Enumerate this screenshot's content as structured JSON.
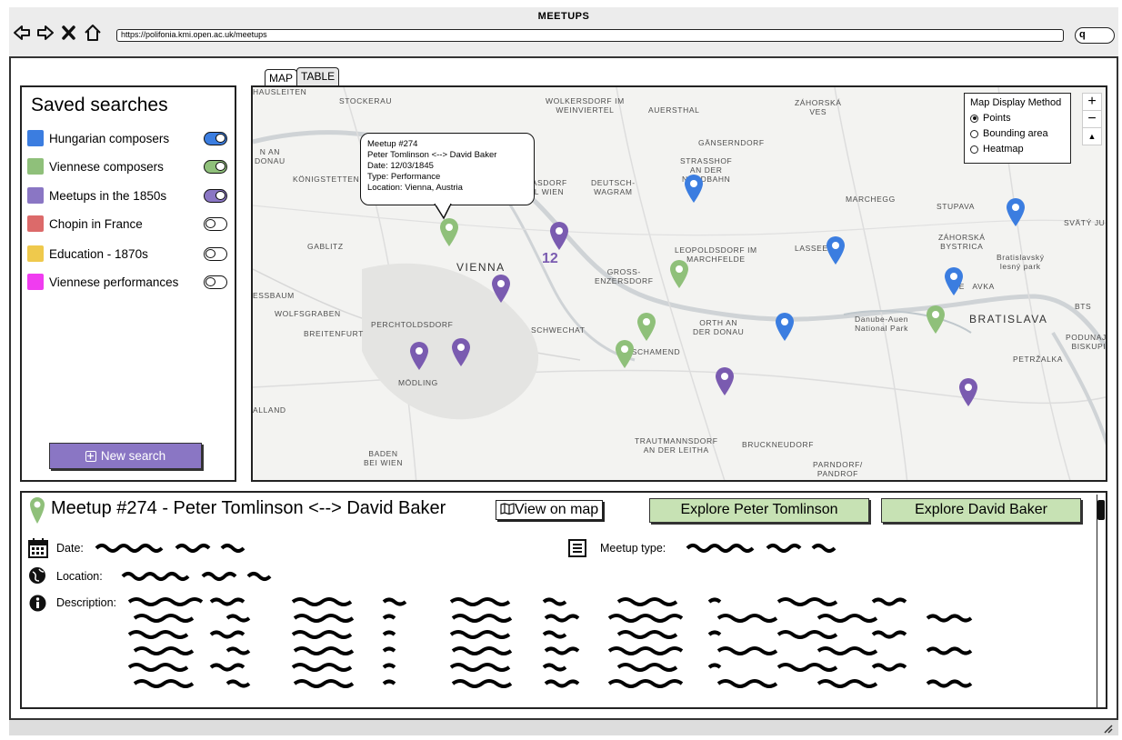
{
  "window": {
    "title": "MEETUPS",
    "url": "https://polifonia.kmi.open.ac.uk/meetups",
    "search_glyph": "q"
  },
  "sidebar": {
    "title": "Saved searches",
    "items": [
      {
        "label": "Hungarian composers",
        "color": "#3b7de0",
        "on": true
      },
      {
        "label": "Viennese composers",
        "color": "#8fc07a",
        "on": true
      },
      {
        "label": "Meetups in the 1850s",
        "color": "#8a76c4",
        "on": true
      },
      {
        "label": "Chopin in France",
        "color": "#dc6a6a",
        "on": false
      },
      {
        "label": "Education - 1870s",
        "color": "#efc94c",
        "on": false
      },
      {
        "label": "Viennese performances",
        "color": "#f03cf0",
        "on": false
      }
    ],
    "new_search": "New search"
  },
  "tabs": {
    "map": "MAP",
    "table": "TABLE"
  },
  "map": {
    "labels": {
      "stockerau": "STOCKERAU",
      "wolkersdorf": "WOLKERSDORF IM\nWEINVIERTEL",
      "auerstahl": "AUERSTHAL",
      "zahorska_ves": "ZÁHORSKÁ\nVES",
      "gansern": "GÄNSERNDORF",
      "strasshof": "STRASSHOF\nAN DER\nNORDBAHN",
      "deutsch_wagram": "DEUTSCH-\nWAGRAM",
      "konigstetten": "KÖNIGSTETTEN",
      "gablitz": "GABLITZ",
      "vienna": "VIENNA",
      "gross_enz": "GROSS-\nENZERSDORF",
      "leopoldsdorf": "LEOPOLDSDORF IM\nMARCHFELDE",
      "lassee": "LASSEE",
      "marchegg": "MARCHEGG",
      "stupava": "STUPAVA",
      "zahorska_bystrica": "ZÁHORSKÁ\nBYSTRICA",
      "bratislavsky": "Bratislavský\nlesný park",
      "svaty": "SVÄTÝ JU",
      "devinska": "DE   AVKA",
      "bratislava": "BRATISLAVA",
      "wolfsgraben": "WOLFSGRABEN",
      "breitenfurt": "BREITENFURT",
      "perchtoldsdorf": "PERCHTOLDSDORF",
      "schwechat": "SCHWECHAT",
      "orth": "ORTH AN\nDER DONAU",
      "donauauen": "Danube-Auen\nNational Park",
      "fischamend": "FISCHAMEND",
      "modling": "MÖDLING",
      "podunajske": "PODUNAJSK\nBISKUPIC",
      "petrzalka": "PETRŽALKA",
      "bts": "BTS",
      "trautmannsdorf": "TRAUTMANNSDORF\nAN DER LEITHA",
      "bruckneudorf": "BRUCKNEUDORF",
      "parndorf": "PARNDORF/\nPANDROF",
      "baden": "BADEN\nBEI WIEN",
      "alland": "ALLAND",
      "essbaum": "ESSBAUM",
      "an_donau": "N AN\nDONAU",
      "hauslteiten": "HAUSLEITEN",
      "nordbahn_left": "RASDORF\nEL WIEN"
    },
    "cluster_count": "12",
    "popup": {
      "line1": "Meetup #274",
      "line2": "Peter Tomlinson <--> David Baker",
      "line3": "Date: 12/03/1845",
      "line4": "Type: Performance",
      "line5": "Location: Vienna, Austria"
    },
    "legend": {
      "title": "Map Display Method",
      "options": [
        {
          "label": "Points",
          "selected": true
        },
        {
          "label": "Bounding area",
          "selected": false
        },
        {
          "label": "Heatmap",
          "selected": false
        }
      ]
    },
    "zoom": {
      "plus": "+",
      "minus": "−",
      "compass": "▲"
    },
    "pins": [
      {
        "color": "#8fc07a"
      },
      {
        "color": "#7a5bb0"
      },
      {
        "color": "#3b7de0"
      },
      {
        "color": "#8fc07a"
      },
      {
        "color": "#3b7de0"
      },
      {
        "color": "#3b7de0"
      },
      {
        "color": "#7a5bb0"
      },
      {
        "color": "#8fc07a"
      },
      {
        "color": "#3b7de0"
      },
      {
        "color": "#8fc07a"
      },
      {
        "color": "#7a5bb0"
      },
      {
        "color": "#7a5bb0"
      },
      {
        "color": "#8fc07a"
      },
      {
        "color": "#7a5bb0"
      },
      {
        "color": "#3b7de0"
      },
      {
        "color": "#7a5bb0"
      }
    ]
  },
  "details": {
    "title": "Meetup #274 - Peter Tomlinson <--> David Baker",
    "view_on_map": "View on map",
    "explore_a": "Explore Peter Tomlinson",
    "explore_b": "Explore David Baker",
    "date_label": "Date:",
    "location_label": "Location:",
    "description_label": "Description:",
    "type_label": "Meetup type:"
  }
}
